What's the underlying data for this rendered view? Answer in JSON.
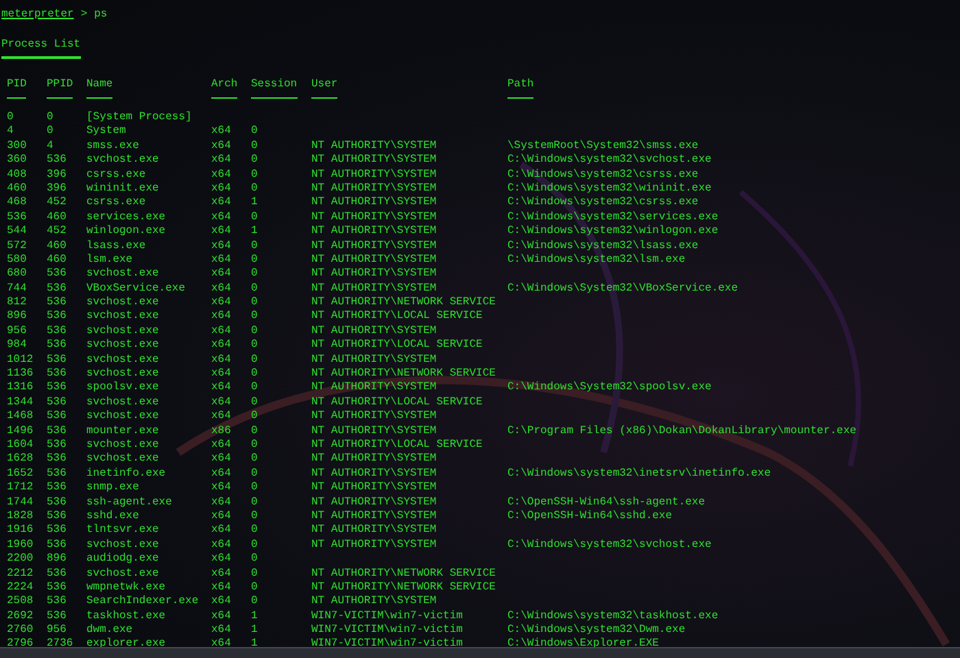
{
  "prompt": {
    "name": "meterpreter",
    "symbol": ">",
    "command": "ps"
  },
  "title": "Process List",
  "columns": [
    "PID",
    "PPID",
    "Name",
    "Arch",
    "Session",
    "User",
    "Path"
  ],
  "rows": [
    {
      "pid": "0",
      "ppid": "0",
      "name": "[System Process]"
    },
    {
      "pid": "4",
      "ppid": "0",
      "name": "System",
      "arch": "x64",
      "session": "0"
    },
    {
      "pid": "300",
      "ppid": "4",
      "name": "smss.exe",
      "arch": "x64",
      "session": "0",
      "user": "NT AUTHORITY\\SYSTEM",
      "path": "\\SystemRoot\\System32\\smss.exe"
    },
    {
      "pid": "360",
      "ppid": "536",
      "name": "svchost.exe",
      "arch": "x64",
      "session": "0",
      "user": "NT AUTHORITY\\SYSTEM",
      "path": "C:\\Windows\\system32\\svchost.exe"
    },
    {
      "pid": "408",
      "ppid": "396",
      "name": "csrss.exe",
      "arch": "x64",
      "session": "0",
      "user": "NT AUTHORITY\\SYSTEM",
      "path": "C:\\Windows\\system32\\csrss.exe"
    },
    {
      "pid": "460",
      "ppid": "396",
      "name": "wininit.exe",
      "arch": "x64",
      "session": "0",
      "user": "NT AUTHORITY\\SYSTEM",
      "path": "C:\\Windows\\system32\\wininit.exe"
    },
    {
      "pid": "468",
      "ppid": "452",
      "name": "csrss.exe",
      "arch": "x64",
      "session": "1",
      "user": "NT AUTHORITY\\SYSTEM",
      "path": "C:\\Windows\\system32\\csrss.exe"
    },
    {
      "pid": "536",
      "ppid": "460",
      "name": "services.exe",
      "arch": "x64",
      "session": "0",
      "user": "NT AUTHORITY\\SYSTEM",
      "path": "C:\\Windows\\system32\\services.exe"
    },
    {
      "pid": "544",
      "ppid": "452",
      "name": "winlogon.exe",
      "arch": "x64",
      "session": "1",
      "user": "NT AUTHORITY\\SYSTEM",
      "path": "C:\\Windows\\system32\\winlogon.exe"
    },
    {
      "pid": "572",
      "ppid": "460",
      "name": "lsass.exe",
      "arch": "x64",
      "session": "0",
      "user": "NT AUTHORITY\\SYSTEM",
      "path": "C:\\Windows\\system32\\lsass.exe"
    },
    {
      "pid": "580",
      "ppid": "460",
      "name": "lsm.exe",
      "arch": "x64",
      "session": "0",
      "user": "NT AUTHORITY\\SYSTEM",
      "path": "C:\\Windows\\system32\\lsm.exe"
    },
    {
      "pid": "680",
      "ppid": "536",
      "name": "svchost.exe",
      "arch": "x64",
      "session": "0",
      "user": "NT AUTHORITY\\SYSTEM"
    },
    {
      "pid": "744",
      "ppid": "536",
      "name": "VBoxService.exe",
      "arch": "x64",
      "session": "0",
      "user": "NT AUTHORITY\\SYSTEM",
      "path": "C:\\Windows\\System32\\VBoxService.exe"
    },
    {
      "pid": "812",
      "ppid": "536",
      "name": "svchost.exe",
      "arch": "x64",
      "session": "0",
      "user": "NT AUTHORITY\\NETWORK SERVICE"
    },
    {
      "pid": "896",
      "ppid": "536",
      "name": "svchost.exe",
      "arch": "x64",
      "session": "0",
      "user": "NT AUTHORITY\\LOCAL SERVICE"
    },
    {
      "pid": "956",
      "ppid": "536",
      "name": "svchost.exe",
      "arch": "x64",
      "session": "0",
      "user": "NT AUTHORITY\\SYSTEM"
    },
    {
      "pid": "984",
      "ppid": "536",
      "name": "svchost.exe",
      "arch": "x64",
      "session": "0",
      "user": "NT AUTHORITY\\LOCAL SERVICE"
    },
    {
      "pid": "1012",
      "ppid": "536",
      "name": "svchost.exe",
      "arch": "x64",
      "session": "0",
      "user": "NT AUTHORITY\\SYSTEM"
    },
    {
      "pid": "1136",
      "ppid": "536",
      "name": "svchost.exe",
      "arch": "x64",
      "session": "0",
      "user": "NT AUTHORITY\\NETWORK SERVICE"
    },
    {
      "pid": "1316",
      "ppid": "536",
      "name": "spoolsv.exe",
      "arch": "x64",
      "session": "0",
      "user": "NT AUTHORITY\\SYSTEM",
      "path": "C:\\Windows\\System32\\spoolsv.exe"
    },
    {
      "pid": "1344",
      "ppid": "536",
      "name": "svchost.exe",
      "arch": "x64",
      "session": "0",
      "user": "NT AUTHORITY\\LOCAL SERVICE"
    },
    {
      "pid": "1468",
      "ppid": "536",
      "name": "svchost.exe",
      "arch": "x64",
      "session": "0",
      "user": "NT AUTHORITY\\SYSTEM"
    },
    {
      "pid": "1496",
      "ppid": "536",
      "name": "mounter.exe",
      "arch": "x86",
      "session": "0",
      "user": "NT AUTHORITY\\SYSTEM",
      "path": "C:\\Program Files (x86)\\Dokan\\DokanLibrary\\mounter.exe"
    },
    {
      "pid": "1604",
      "ppid": "536",
      "name": "svchost.exe",
      "arch": "x64",
      "session": "0",
      "user": "NT AUTHORITY\\LOCAL SERVICE"
    },
    {
      "pid": "1628",
      "ppid": "536",
      "name": "svchost.exe",
      "arch": "x64",
      "session": "0",
      "user": "NT AUTHORITY\\SYSTEM"
    },
    {
      "pid": "1652",
      "ppid": "536",
      "name": "inetinfo.exe",
      "arch": "x64",
      "session": "0",
      "user": "NT AUTHORITY\\SYSTEM",
      "path": "C:\\Windows\\system32\\inetsrv\\inetinfo.exe"
    },
    {
      "pid": "1712",
      "ppid": "536",
      "name": "snmp.exe",
      "arch": "x64",
      "session": "0",
      "user": "NT AUTHORITY\\SYSTEM"
    },
    {
      "pid": "1744",
      "ppid": "536",
      "name": "ssh-agent.exe",
      "arch": "x64",
      "session": "0",
      "user": "NT AUTHORITY\\SYSTEM",
      "path": "C:\\OpenSSH-Win64\\ssh-agent.exe"
    },
    {
      "pid": "1828",
      "ppid": "536",
      "name": "sshd.exe",
      "arch": "x64",
      "session": "0",
      "user": "NT AUTHORITY\\SYSTEM",
      "path": "C:\\OpenSSH-Win64\\sshd.exe"
    },
    {
      "pid": "1916",
      "ppid": "536",
      "name": "tlntsvr.exe",
      "arch": "x64",
      "session": "0",
      "user": "NT AUTHORITY\\SYSTEM"
    },
    {
      "pid": "1960",
      "ppid": "536",
      "name": "svchost.exe",
      "arch": "x64",
      "session": "0",
      "user": "NT AUTHORITY\\SYSTEM",
      "path": "C:\\Windows\\system32\\svchost.exe"
    },
    {
      "pid": "2200",
      "ppid": "896",
      "name": "audiodg.exe",
      "arch": "x64",
      "session": "0"
    },
    {
      "pid": "2212",
      "ppid": "536",
      "name": "svchost.exe",
      "arch": "x64",
      "session": "0",
      "user": "NT AUTHORITY\\NETWORK SERVICE"
    },
    {
      "pid": "2224",
      "ppid": "536",
      "name": "wmpnetwk.exe",
      "arch": "x64",
      "session": "0",
      "user": "NT AUTHORITY\\NETWORK SERVICE"
    },
    {
      "pid": "2508",
      "ppid": "536",
      "name": "SearchIndexer.exe",
      "arch": "x64",
      "session": "0",
      "user": "NT AUTHORITY\\SYSTEM"
    },
    {
      "pid": "2692",
      "ppid": "536",
      "name": "taskhost.exe",
      "arch": "x64",
      "session": "1",
      "user": "WIN7-VICTIM\\win7-victim",
      "path": "C:\\Windows\\system32\\taskhost.exe"
    },
    {
      "pid": "2760",
      "ppid": "956",
      "name": "dwm.exe",
      "arch": "x64",
      "session": "1",
      "user": "WIN7-VICTIM\\win7-victim",
      "path": "C:\\Windows\\system32\\Dwm.exe"
    },
    {
      "pid": "2796",
      "ppid": "2736",
      "name": "explorer.exe",
      "arch": "x64",
      "session": "1",
      "user": "WIN7-VICTIM\\win7-victim",
      "path": "C:\\Windows\\Explorer.EXE"
    }
  ]
}
